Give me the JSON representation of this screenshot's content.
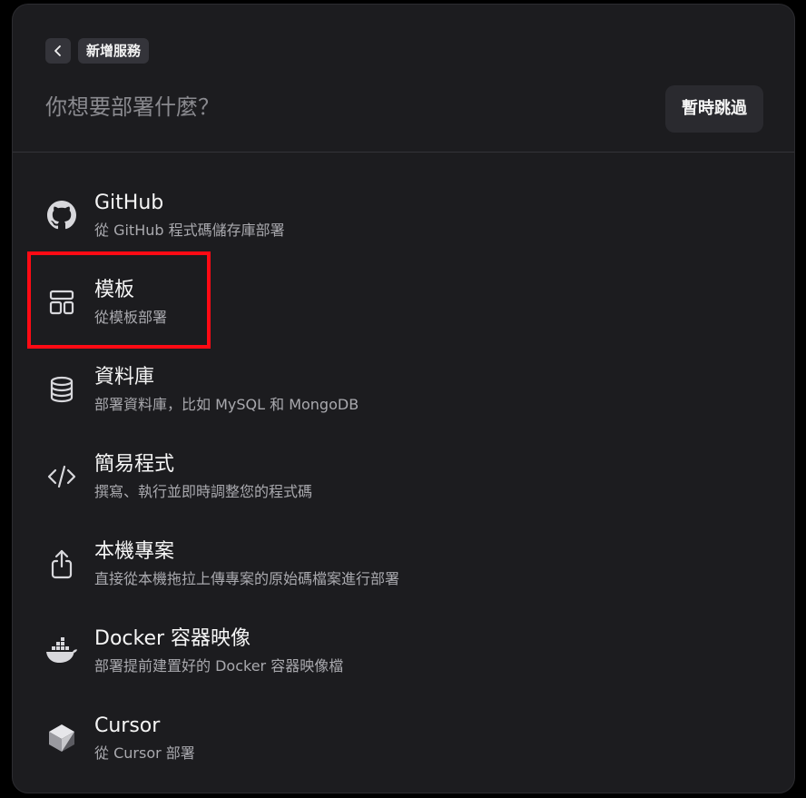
{
  "header": {
    "back_icon": "chevron-left-icon",
    "breadcrumb": "新增服務",
    "question": "你想要部署什麼？",
    "skip_label": "暫時跳過"
  },
  "options": [
    {
      "title": "GitHub",
      "description": "從 GitHub 程式碼儲存庫部署",
      "icon": "github-icon"
    },
    {
      "title": "模板",
      "description": "從模板部署",
      "icon": "template-layout-icon"
    },
    {
      "title": "資料庫",
      "description": "部署資料庫，比如 MySQL 和 MongoDB",
      "icon": "database-icon"
    },
    {
      "title": "簡易程式",
      "description": "撰寫、執行並即時調整您的程式碼",
      "icon": "code-icon"
    },
    {
      "title": "本機專案",
      "description": "直接從本機拖拉上傳專案的原始碼檔案進行部署",
      "icon": "upload-share-icon"
    },
    {
      "title": "Docker 容器映像",
      "description": "部署提前建置好的 Docker 容器映像檔",
      "icon": "docker-icon"
    },
    {
      "title": "Cursor",
      "description": "從 Cursor 部署",
      "icon": "cursor-icon"
    }
  ],
  "colors": {
    "panel_bg": "#1c1c1f",
    "highlight": "#ff0a14",
    "text_primary": "#f5f5f5",
    "text_secondary": "#a9a9ae"
  }
}
